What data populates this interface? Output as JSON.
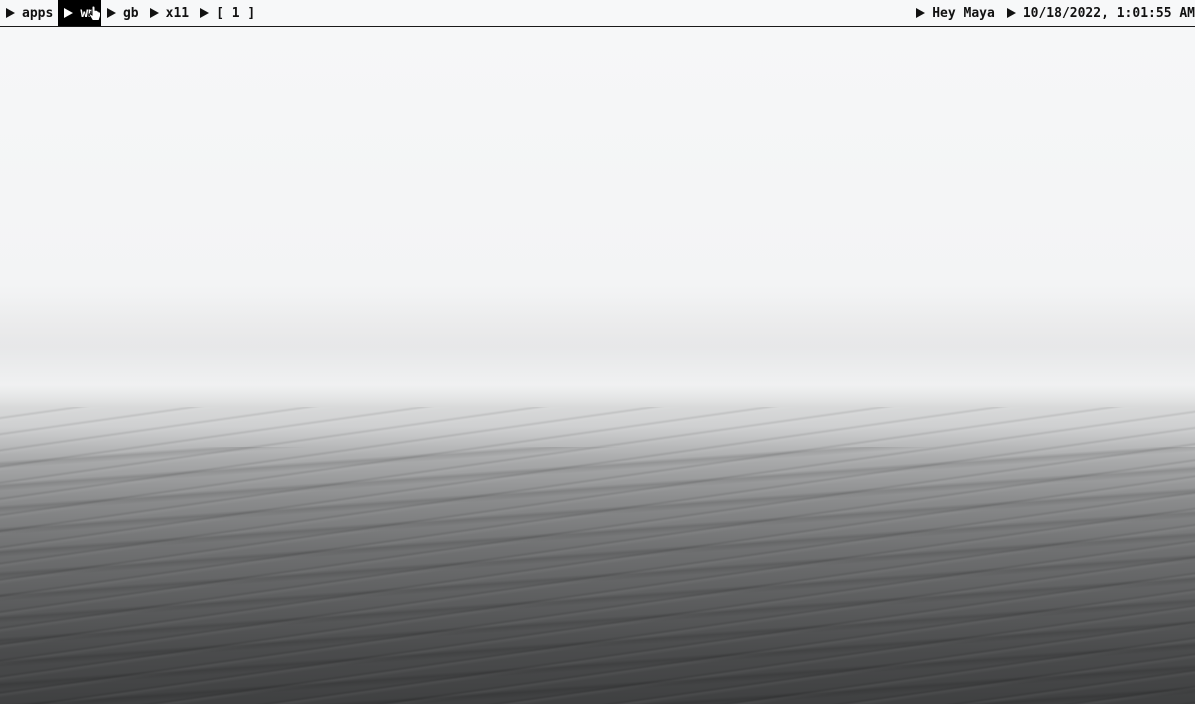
{
  "topbar": {
    "left_items": [
      {
        "label": "apps"
      },
      {
        "label": "wm",
        "active": true
      },
      {
        "label": "gb"
      },
      {
        "label": "x11"
      },
      {
        "label": "[ 1 ]"
      }
    ],
    "greeting": "Hey Maya",
    "datetime": "10/18/2022, 1:01:55 AM"
  },
  "icons": {
    "item_marker": "play-triangle-icon",
    "pointer": "hand-pointer-cursor-icon"
  },
  "colors": {
    "bar_background": "#f7f8f9",
    "active_background": "#000000",
    "text": "#111111"
  },
  "wallpaper": {
    "description_tag": "grayscale-foggy-sea"
  }
}
